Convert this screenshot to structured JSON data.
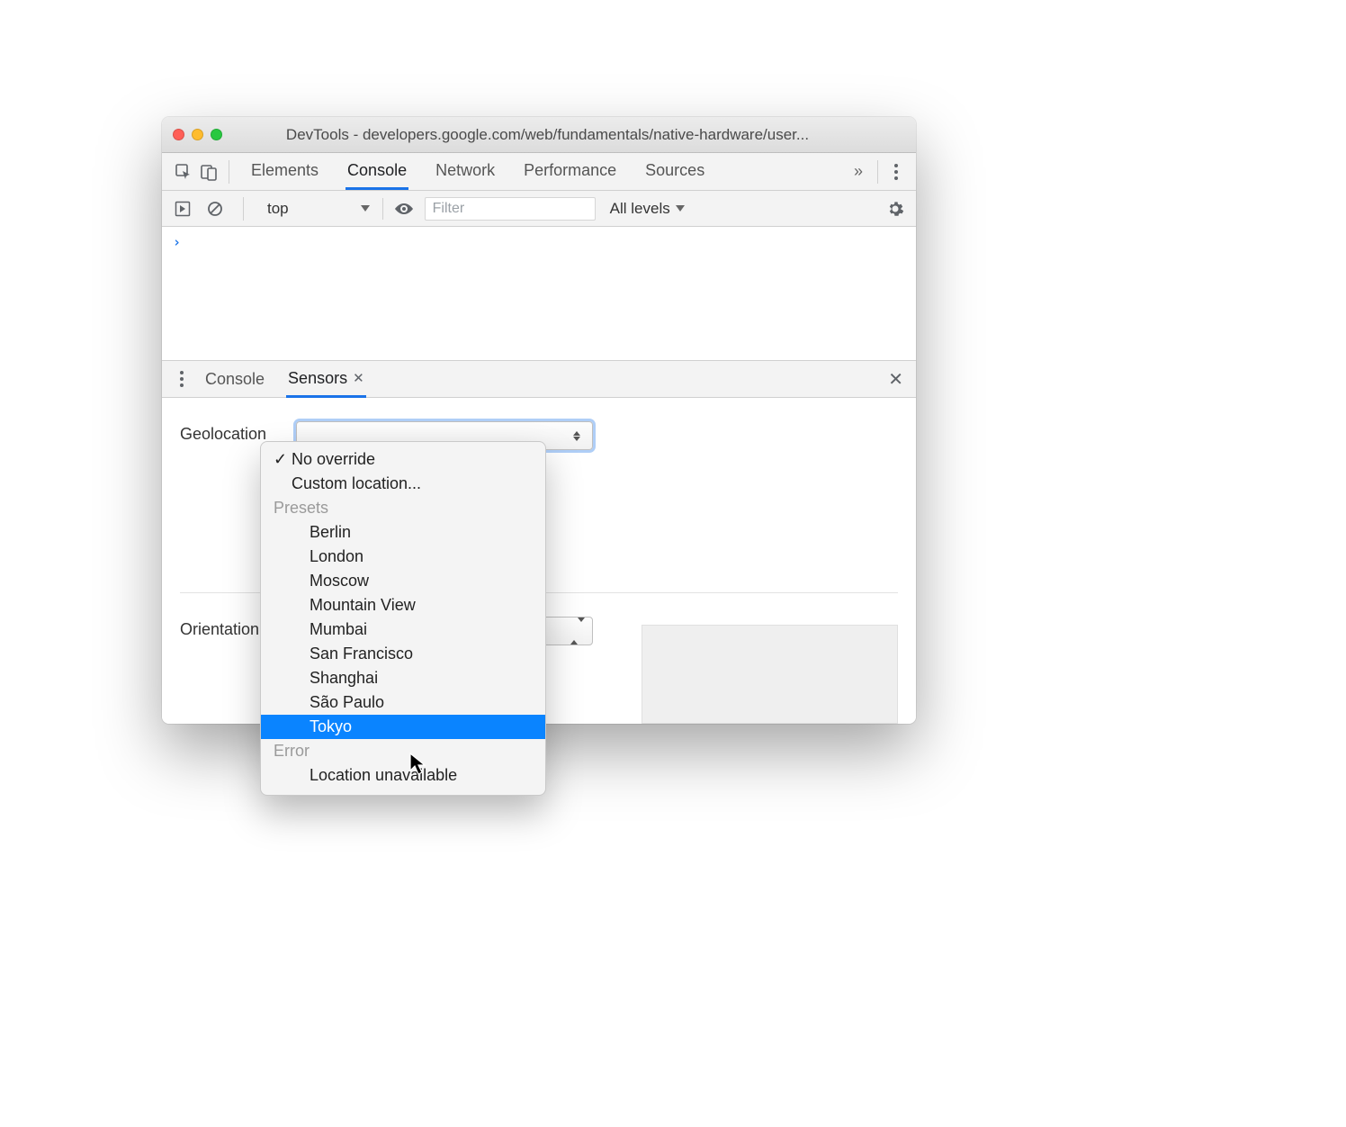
{
  "window": {
    "title": "DevTools - developers.google.com/web/fundamentals/native-hardware/user..."
  },
  "main_tabs": {
    "items": [
      "Elements",
      "Console",
      "Network",
      "Performance",
      "Sources"
    ],
    "active_index": 1
  },
  "console_toolbar": {
    "context": "top",
    "filter_placeholder": "Filter",
    "levels": "All levels"
  },
  "drawer_tabs": {
    "items": [
      "Console",
      "Sensors"
    ],
    "active_index": 1
  },
  "sensors": {
    "geolocation_label": "Geolocation",
    "orientation_label": "Orientation"
  },
  "dropdown": {
    "top_options": [
      "No override",
      "Custom location..."
    ],
    "selected_top_index": 0,
    "group_presets_label": "Presets",
    "presets": [
      "Berlin",
      "London",
      "Moscow",
      "Mountain View",
      "Mumbai",
      "San Francisco",
      "Shanghai",
      "São Paulo",
      "Tokyo"
    ],
    "highlight_index": 8,
    "group_error_label": "Error",
    "error_options": [
      "Location unavailable"
    ]
  }
}
